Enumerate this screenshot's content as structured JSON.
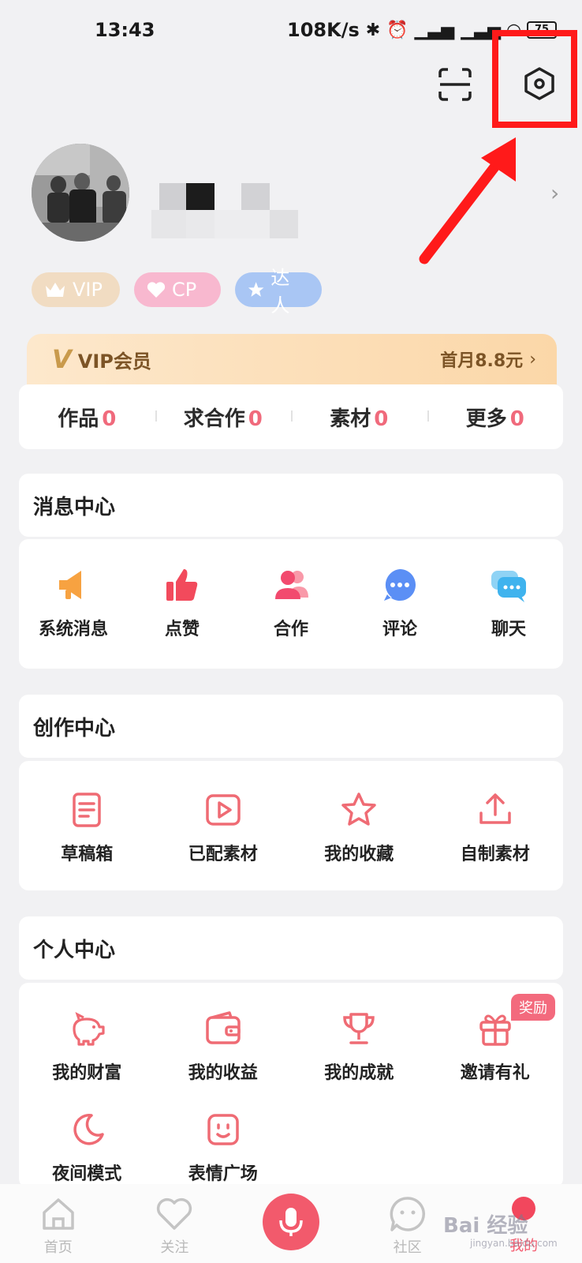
{
  "status_bar": {
    "time": "13:43",
    "network_speed": "108K/s",
    "battery": "75"
  },
  "header": {
    "scan_icon": "scan-icon",
    "settings_icon": "settings-hexagon-icon"
  },
  "profile": {
    "chevron": "›"
  },
  "badges": [
    {
      "label": "VIP",
      "icon": "crown-icon",
      "color": "#f1dcc2"
    },
    {
      "label": "CP",
      "icon": "heart-icon",
      "color": "#f8b8cf"
    },
    {
      "label": "达人",
      "icon": "star-icon",
      "color": "#a9c6f4"
    }
  ],
  "vip_banner": {
    "title": "VIP会员",
    "price": "首月8.8元",
    "chevron": "›"
  },
  "stats": [
    {
      "label": "作品",
      "value": "0"
    },
    {
      "label": "求合作",
      "value": "0"
    },
    {
      "label": "素材",
      "value": "0"
    },
    {
      "label": "更多",
      "value": "0"
    }
  ],
  "message_center": {
    "title": "消息中心",
    "items": [
      {
        "label": "系统消息",
        "icon": "megaphone-icon"
      },
      {
        "label": "点赞",
        "icon": "thumbs-up-icon"
      },
      {
        "label": "合作",
        "icon": "users-icon"
      },
      {
        "label": "评论",
        "icon": "comment-icon"
      },
      {
        "label": "聊天",
        "icon": "chat-icon"
      }
    ]
  },
  "creation_center": {
    "title": "创作中心",
    "items": [
      {
        "label": "草稿箱",
        "icon": "draft-icon"
      },
      {
        "label": "已配素材",
        "icon": "video-play-icon"
      },
      {
        "label": "我的收藏",
        "icon": "star-outline-icon"
      },
      {
        "label": "自制素材",
        "icon": "upload-icon"
      }
    ]
  },
  "personal_center": {
    "title": "个人中心",
    "reward_tag": "奖励",
    "items": [
      {
        "label": "我的财富",
        "icon": "piggy-bank-icon"
      },
      {
        "label": "我的收益",
        "icon": "wallet-icon"
      },
      {
        "label": "我的成就",
        "icon": "trophy-icon"
      },
      {
        "label": "邀请有礼",
        "icon": "gift-icon"
      },
      {
        "label": "夜间模式",
        "icon": "moon-icon"
      },
      {
        "label": "表情广场",
        "icon": "emoji-icon"
      }
    ]
  },
  "bottom_nav": [
    {
      "label": "首页",
      "icon": "home-icon"
    },
    {
      "label": "关注",
      "icon": "heart-outline-icon"
    },
    {
      "label": "",
      "icon": "microphone-icon"
    },
    {
      "label": "社区",
      "icon": "community-icon"
    },
    {
      "label": "我的",
      "icon": "profile-dot-icon"
    }
  ],
  "watermark": {
    "text": "Bai 经验",
    "sub": "jingyan.baidu.com"
  },
  "colors": {
    "accent": "#f25a6c",
    "highlight": "#ff1a1a",
    "icon_orange": "#f7a241",
    "icon_blue": "#5b8ff5"
  }
}
